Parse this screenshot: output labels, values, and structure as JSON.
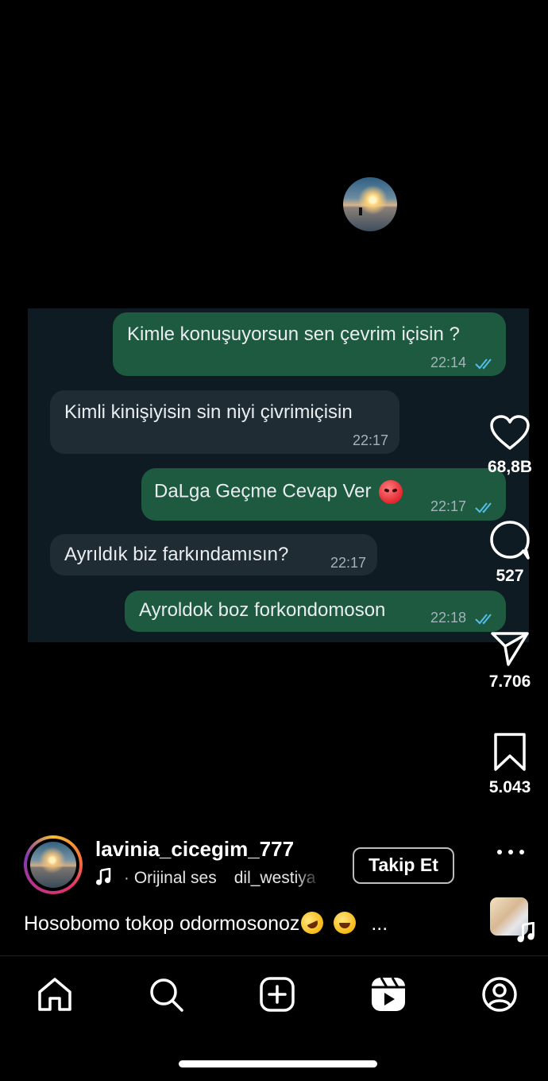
{
  "chat": {
    "messages": [
      {
        "text": "Kimle konuşuyorsun sen çevrim içisin ?",
        "time": "22:14",
        "direction": "out"
      },
      {
        "text": "Kimli kinişiyisin sin niyi çivrimiçisin",
        "time": "22:17",
        "direction": "in"
      },
      {
        "text": "DaLga Geçme Cevap Ver",
        "time": "22:17",
        "direction": "out",
        "emoji": "angry-face"
      },
      {
        "text": "Ayrıldık biz farkındamısın?",
        "time": "22:17",
        "direction": "in"
      },
      {
        "text": "Ayroldok  boz forkondomoson",
        "time": "22:18",
        "direction": "out"
      }
    ]
  },
  "actions": {
    "likes": "68,8B",
    "comments": "527",
    "shares": "7.706",
    "saves": "5.043"
  },
  "author": {
    "username": "lavinia_cicegim_777",
    "audio_label": "Orijinal ses",
    "audio_owner": "dil_westiya",
    "follow_label": "Takip Et"
  },
  "caption": {
    "text": "Hosobomo tokop odormosonoz",
    "emojis": [
      "rolling-on-floor-laughing",
      "tears-of-joy"
    ],
    "more": "..."
  },
  "nav": {
    "items": [
      "home-icon",
      "search-icon",
      "create-icon",
      "reels-icon",
      "profile-icon"
    ]
  },
  "colors": {
    "outgoing_bubble": "#1d5a40",
    "incoming_bubble": "#1f2c33",
    "chat_background": "#0f1b22",
    "read_ticks": "#53bdeb"
  }
}
